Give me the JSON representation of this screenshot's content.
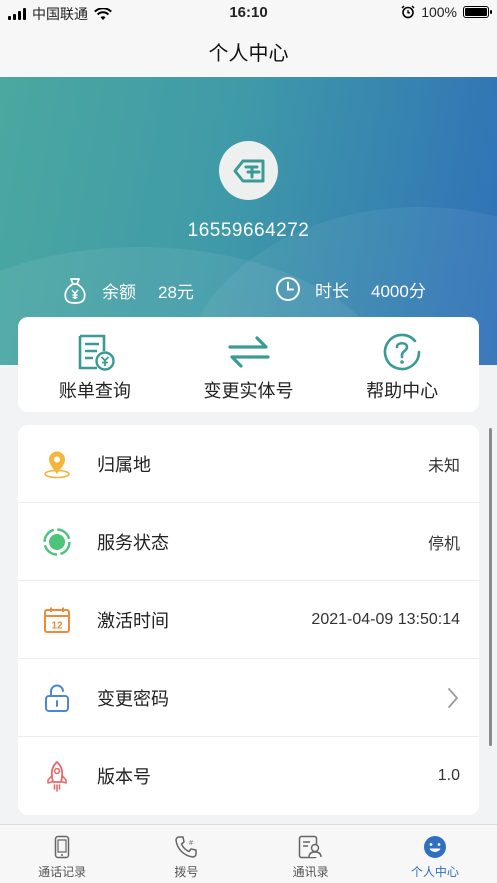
{
  "status_bar": {
    "carrier": "中国联通",
    "time": "16:10",
    "battery": "100%",
    "battery_level": 1.0
  },
  "nav": {
    "title": "个人中心"
  },
  "profile": {
    "phone": "16559664272",
    "balance_label": "余额",
    "balance_value": "28元",
    "duration_label": "时长",
    "duration_value": "4000分"
  },
  "quick_actions": [
    {
      "label": "账单查询",
      "icon": "bill-icon"
    },
    {
      "label": "变更实体号",
      "icon": "swap-arrows-icon"
    },
    {
      "label": "帮助中心",
      "icon": "help-icon"
    }
  ],
  "info": [
    {
      "label": "归属地",
      "value": "未知",
      "icon": "location-pin-icon"
    },
    {
      "label": "服务状态",
      "value": "停机",
      "icon": "status-dot-icon"
    },
    {
      "label": "激活时间",
      "value": "2021-04-09 13:50:14",
      "icon": "calendar-icon"
    },
    {
      "label": "变更密码",
      "value": "",
      "icon": "unlock-icon"
    },
    {
      "label": "版本号",
      "value": "1.0",
      "icon": "rocket-icon"
    }
  ],
  "calendar_day": "12",
  "tabs": [
    {
      "label": "通话记录",
      "icon": "phone-device-icon",
      "active": false
    },
    {
      "label": "拨号",
      "icon": "dial-icon",
      "active": false
    },
    {
      "label": "通讯录",
      "icon": "contacts-icon",
      "active": false
    },
    {
      "label": "个人中心",
      "icon": "smile-icon",
      "active": true
    }
  ],
  "colors": {
    "accent": "#2f6fc2",
    "teal": "#3a9a94",
    "header_start": "#4aa8a0",
    "header_end": "#2f70b8"
  }
}
